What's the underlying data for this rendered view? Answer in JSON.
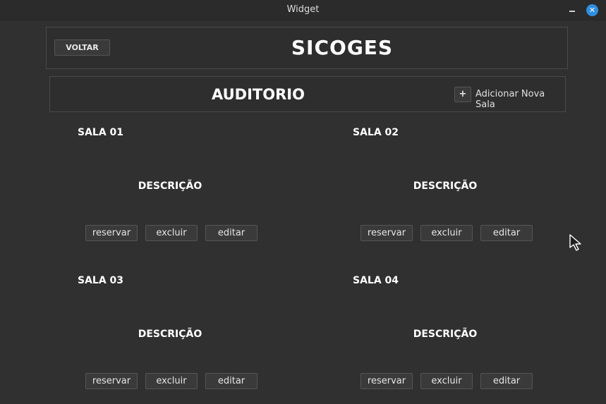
{
  "window": {
    "title": "Widget"
  },
  "header": {
    "back_label": "VOLTAR",
    "app_title": "SICOGES"
  },
  "section": {
    "title": "AUDITORIO",
    "add_symbol": "+",
    "add_label": "Adicionar Nova Sala"
  },
  "rooms": [
    {
      "name": "SALA 01",
      "description": "DESCRIÇÃO",
      "reserve": "reservar",
      "delete": "excluir",
      "edit": "editar"
    },
    {
      "name": "SALA 02",
      "description": "DESCRIÇÃO",
      "reserve": "reservar",
      "delete": "excluir",
      "edit": "editar"
    },
    {
      "name": "SALA 03",
      "description": "DESCRIÇÃO",
      "reserve": "reservar",
      "delete": "excluir",
      "edit": "editar"
    },
    {
      "name": "SALA 04",
      "description": "DESCRIÇÃO",
      "reserve": "reservar",
      "delete": "excluir",
      "edit": "editar"
    }
  ],
  "colors": {
    "background": "#303030",
    "accent_close": "#2f8ee0",
    "text": "#ffffff"
  }
}
